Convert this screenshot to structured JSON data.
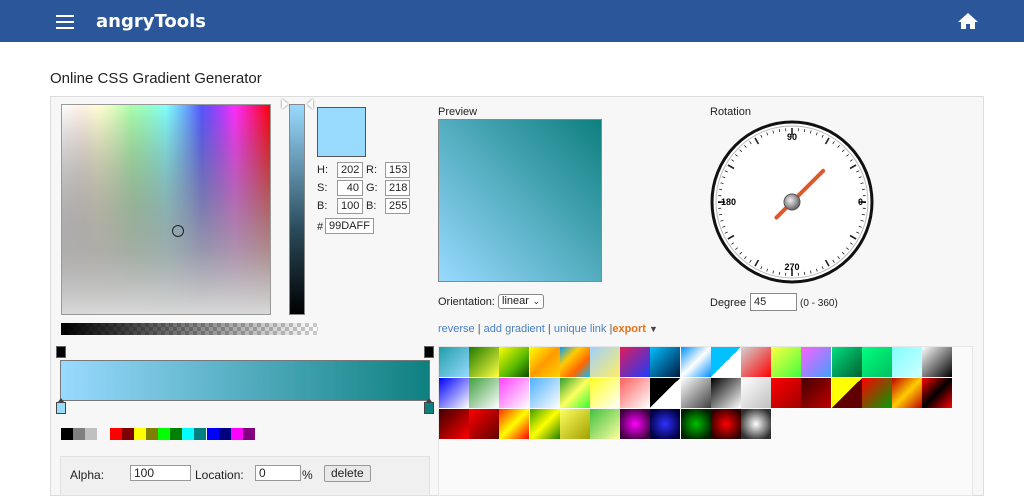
{
  "header": {
    "brand": "angryTools",
    "menu_icon": "menu-icon",
    "home_icon": "home-icon",
    "bg": "#2b579a"
  },
  "page": {
    "title": "Online CSS Gradient Generator"
  },
  "color_picker": {
    "current_color": "#99DAFF",
    "fields": {
      "H": "202",
      "S": "40",
      "B_hsb": "100",
      "R": "153",
      "G": "218",
      "B_rgb": "255"
    },
    "labels": {
      "h": "H:",
      "s": "S:",
      "b1": "B:",
      "r": "R:",
      "g": "G:",
      "b2": "B:",
      "hash": "#"
    },
    "hex": "99DAFF",
    "swatches": [
      "#000000",
      "#808080",
      "#c0c0c0",
      "#ff0000",
      "#800000",
      "#ffff00",
      "#808000",
      "#00ff00",
      "#008000",
      "#00ffff",
      "#008080",
      "#0000ff",
      "#000080",
      "#ff00ff",
      "#800080"
    ]
  },
  "gradient_editor": {
    "stops": [
      {
        "color": "#99daff",
        "location": 0
      },
      {
        "color": "#0e8080",
        "location": 100
      }
    ],
    "stop_fields": {
      "alpha_label": "Alpha:",
      "alpha_value": "100",
      "location_label": "Location:",
      "location_value": "0",
      "percent": "%",
      "delete_label": "delete"
    }
  },
  "preview": {
    "title": "Preview",
    "orientation_label": "Orientation:",
    "orientation_value": "linear"
  },
  "rotation": {
    "title": "Rotation",
    "degree_label": "Degree",
    "degree_value": "45",
    "range_hint": "(0 - 360)",
    "dial_labels": {
      "top": "90",
      "bottom": "270",
      "left": "-180",
      "right": "0-"
    }
  },
  "actions": {
    "reverse": "reverse",
    "add_gradient": "add gradient",
    "unique_link": "unique link",
    "export": "export",
    "sep": "|"
  },
  "presets": [
    "linear-gradient(135deg,#1f9ea8,#99daff)",
    "linear-gradient(135deg,#1e7a00,#ffff40)",
    "linear-gradient(135deg,#fffe00,#52b700 60%,#0b4a00)",
    "linear-gradient(135deg,#ffff00,#ff9900,#ffd400)",
    "linear-gradient(135deg,#0099ff,#ffcc00,#ff6600,#00c0ff)",
    "linear-gradient(135deg,#a0d0ff,#ffee66)",
    "linear-gradient(135deg,#e21a5a,#1a3cff)",
    "linear-gradient(135deg,#00c0ff,#001a44)",
    "linear-gradient(135deg,#0090ff,#ffffff,#0090ff)",
    "linear-gradient(135deg,#00c0ff 50%,#ffffff 50%)",
    "linear-gradient(135deg,#d2d2d2,#ff0000)",
    "linear-gradient(135deg,#ffff40,#40ff40)",
    "linear-gradient(135deg,#ff60ff,#40a0ff)",
    "linear-gradient(135deg,#00e080,#006030)",
    "linear-gradient(135deg,#00ff80,#00c060)",
    "linear-gradient(135deg,#80ffff,#d0ffff)",
    "linear-gradient(135deg,#ffffff,#000000)",
    "linear-gradient(135deg,#0000ff,#ffffff)",
    "linear-gradient(135deg,#40a040,#ffffff)",
    "linear-gradient(135deg,#ff40ff,#ffffff)",
    "linear-gradient(135deg,#50b0ff,#ffffff)",
    "linear-gradient(135deg,#30a030,#ffff60,#30ff30)",
    "linear-gradient(135deg,#ffff20,#ffffff)",
    "linear-gradient(135deg,#ff6060,#ffffff)",
    "linear-gradient(135deg,#000000 50%,#ffffff 50%)",
    "linear-gradient(135deg,#ffffff,#404040)",
    "linear-gradient(135deg,#000000,#ffffff)",
    "linear-gradient(135deg,#ffffff,#c0c0c0)",
    "linear-gradient(135deg,#ff0000,#a00000)",
    "linear-gradient(135deg,#400000,#c00000)",
    "linear-gradient(135deg,#ffff00 50%,#600000 50%)",
    "linear-gradient(135deg,#ff0000,#00a000)",
    "linear-gradient(135deg,#c00000,#ffcc00,#c00000)",
    "linear-gradient(135deg,#ff0000,#000000,#ff0000)",
    "linear-gradient(135deg,#400000,#ff0000)",
    "linear-gradient(135deg,#ff0000,#600000)",
    "linear-gradient(135deg,#ff3000,#ffff00,#ff0000)",
    "linear-gradient(135deg,#40a000,#ffff00,#208000)",
    "linear-gradient(135deg,#ffff60,#a0a000)",
    "linear-gradient(135deg,#40c040,#ffffa0)",
    "radial-gradient(#ff00ff,#400040 80%)",
    "radial-gradient(#3030ff,#000040 80%)",
    "radial-gradient(#00c000,#002000 80%)",
    "radial-gradient(#ff0000,#300000 80%)",
    "radial-gradient(#ffffff,#303030 80%)"
  ]
}
